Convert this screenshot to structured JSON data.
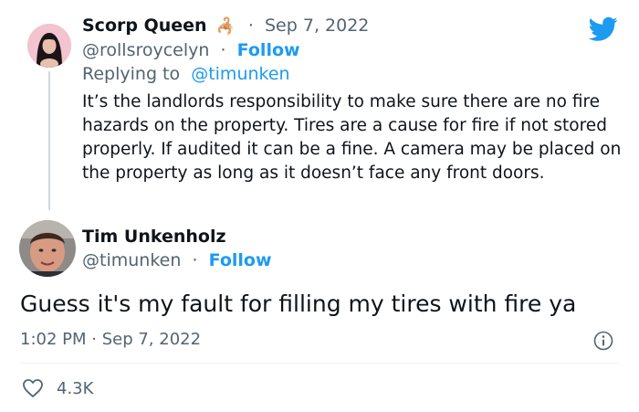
{
  "reply_tweet": {
    "author_name": "Scorp Queen",
    "author_emoji": "🦂",
    "date": "Sep 7, 2022",
    "handle": "@rollsroycelyn",
    "follow_label": "Follow",
    "replying_to_prefix": "Replying to",
    "replying_to_handle": "@timunken",
    "text": "It’s the landlords responsibility to make sure there are no fire hazards on the property. Tires are a cause for fire if not stored properly. If audited it can be a fine. A camera may be placed on the property as long as it doesn’t face any front doors."
  },
  "main_tweet": {
    "author_name": "Tim Unkenholz",
    "handle": "@timunken",
    "follow_label": "Follow",
    "text": "Guess it's my fault for filling my tires with fire ya",
    "timestamp": "1:02 PM · Sep 7, 2022",
    "likes": "4.3K"
  },
  "separator": "·",
  "colors": {
    "accent": "#1d9bf0",
    "muted": "#536471",
    "text": "#0f1419"
  },
  "icons": [
    "twitter-bird-icon",
    "info-icon",
    "heart-icon",
    "scorpion-emoji-icon"
  ]
}
